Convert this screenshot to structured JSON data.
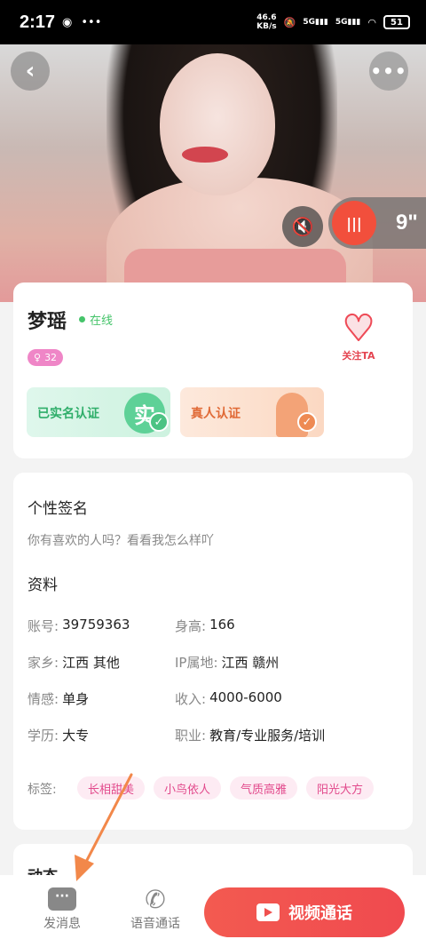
{
  "status_bar": {
    "time": "2:17",
    "net_speed_value": "46.6",
    "net_speed_unit": "KB/s",
    "signal_1": "5G",
    "signal_2": "5G",
    "battery": "51",
    "icons": [
      "notification-dot-icon",
      "more-dots-icon",
      "mute-icon",
      "signal-icon",
      "wifi-icon",
      "battery-icon"
    ]
  },
  "hero": {
    "voice_duration": "9\"",
    "icons": [
      "back-icon",
      "more-icon",
      "sound-off-icon",
      "voice-wave-icon"
    ]
  },
  "profile": {
    "name": "梦瑶",
    "status": "在线",
    "age_badge": "32",
    "follow_label": "关注TA",
    "verify_real_name": "已实名认证",
    "verify_real_name_glyph": "实",
    "verify_real_person": "真人认证"
  },
  "info": {
    "signature_title": "个性签名",
    "signature_text": "你有喜欢的人吗？看看我怎么样吖",
    "details_title": "资料",
    "fields": [
      {
        "key": "账号:",
        "value": "39759363"
      },
      {
        "key": "身高:",
        "value": "166"
      },
      {
        "key": "家乡:",
        "value": "江西 其他"
      },
      {
        "key": "IP属地:",
        "value": "江西 赣州"
      },
      {
        "key": "情感:",
        "value": "单身"
      },
      {
        "key": "收入:",
        "value": "4000-6000"
      },
      {
        "key": "学历:",
        "value": "大专"
      },
      {
        "key": "职业:",
        "value": "教育/专业服务/培训"
      }
    ],
    "tags_label": "标签:",
    "tags": [
      "长相甜美",
      "小鸟依人",
      "气质高雅",
      "阳光大方"
    ]
  },
  "dynamics": {
    "title": "动态"
  },
  "bottom_bar": {
    "message_label": "发消息",
    "voice_call_label": "语音通话",
    "video_call_label": "视频通话"
  },
  "colors": {
    "accent_red": "#f04a4f",
    "online_green": "#45c46a",
    "tag_pink": "#e24a8c",
    "annotation_arrow": "#f2884a"
  }
}
